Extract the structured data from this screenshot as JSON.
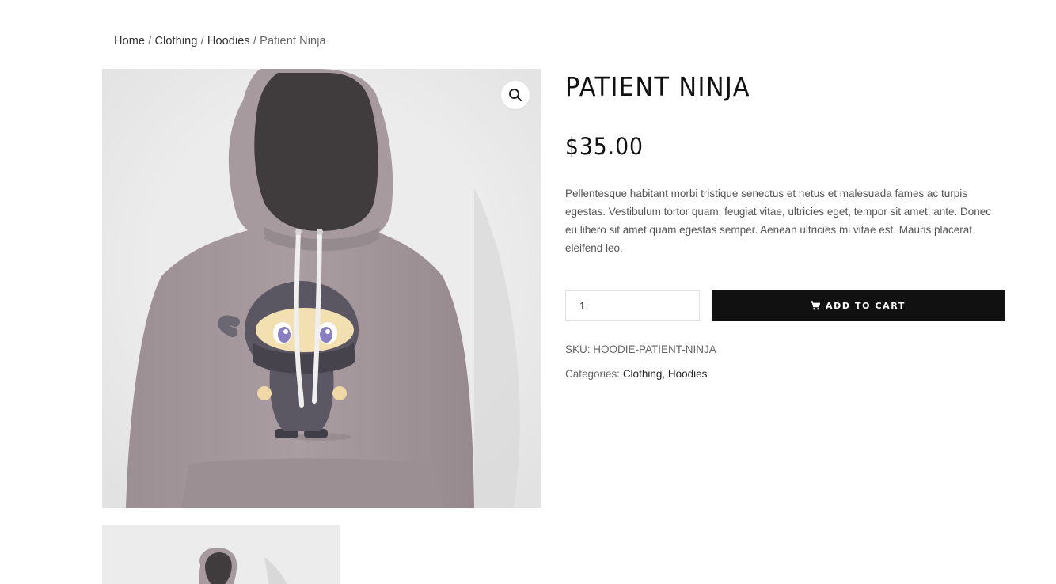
{
  "breadcrumb": {
    "home": "Home",
    "category": "Clothing",
    "subcategory": "Hoodies",
    "current": "Patient Ninja",
    "separator": " / "
  },
  "product": {
    "title": "PATIENT NINJA",
    "price": "$35.00",
    "description": "Pellentesque habitant morbi tristique senectus et netus et malesuada fames ac turpis egestas. Vestibulum tortor quam, feugiat vitae, ultricies eget, tempor sit amet, ante. Donec eu libero sit amet quam egestas semper. Aenean ultricies mi vitae est. Mauris placerat eleifend leo.",
    "quantity": "1",
    "add_to_cart_label": "ADD TO CART",
    "sku_label": "SKU:",
    "sku_value": "HOODIE-PATIENT-NINJA",
    "categories_label": "Categories:",
    "categories": [
      "Clothing",
      "Hoodies"
    ],
    "categories_separator": ","
  },
  "icons": {
    "zoom": "magnifier-icon",
    "cart": "cart-icon"
  },
  "colors": {
    "button_bg": "#111111",
    "hoodie": "#a79a9e",
    "image_bg": "#ececec"
  }
}
